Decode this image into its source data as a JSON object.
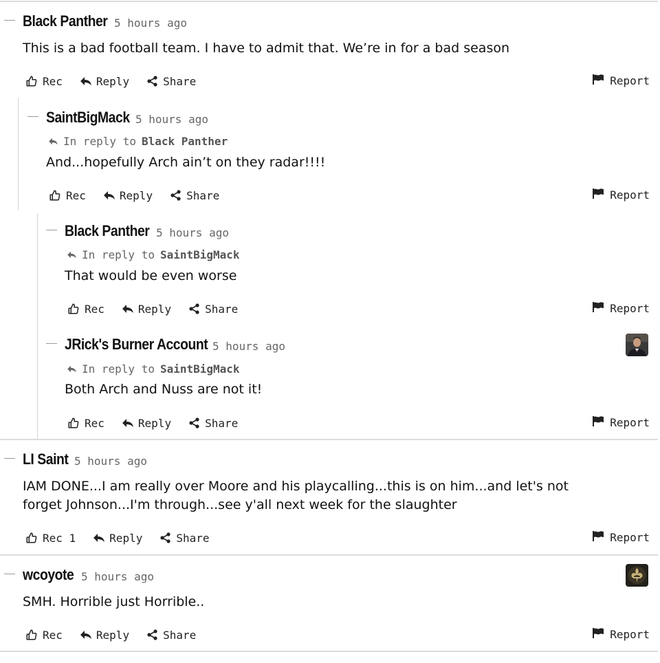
{
  "labels": {
    "rec": "Rec",
    "reply": "Reply",
    "share": "Share",
    "report": "Report",
    "in_reply_to": "In reply to"
  },
  "comments": [
    {
      "author": "Black Panther",
      "time": "5 hours ago",
      "in_reply_to": "",
      "body": "This is a bad football team. I have to admit that. We’re in for a bad season",
      "rec_label": "Rec",
      "has_avatar": false
    },
    {
      "author": "SaintBigMack",
      "time": "5 hours ago",
      "in_reply_to": "Black Panther",
      "body": "And...hopefully Arch ain’t on they radar!!!!",
      "rec_label": "Rec",
      "has_avatar": false
    },
    {
      "author": "Black Panther",
      "time": "5 hours ago",
      "in_reply_to": "SaintBigMack",
      "body": "That would be even worse",
      "rec_label": "Rec",
      "has_avatar": false
    },
    {
      "author": "JRick's Burner Account",
      "time": "5 hours ago",
      "in_reply_to": "SaintBigMack",
      "body": "Both Arch and Nuss are not it!",
      "rec_label": "Rec",
      "has_avatar": true,
      "avatar_icon": "man-in-suit-avatar"
    },
    {
      "author": "LI Saint",
      "time": "5 hours ago",
      "in_reply_to": "",
      "body": "IAM DONE...I am really over Moore and his playcalling...this is on him...and let's not forget Johnson...I'm through...see y'all next week for the slaughter",
      "rec_label": "Rec 1",
      "has_avatar": false
    },
    {
      "author": "wcoyote",
      "time": "5 hours ago",
      "in_reply_to": "",
      "body": "SMH. Horrible just Horrible..",
      "rec_label": "Rec",
      "has_avatar": true,
      "avatar_icon": "fleur-de-lis-avatar"
    }
  ],
  "colors": {
    "text": "#111111",
    "muted": "#666666",
    "divider": "#dcdcdc",
    "thread_line": "#d4d4d4"
  }
}
